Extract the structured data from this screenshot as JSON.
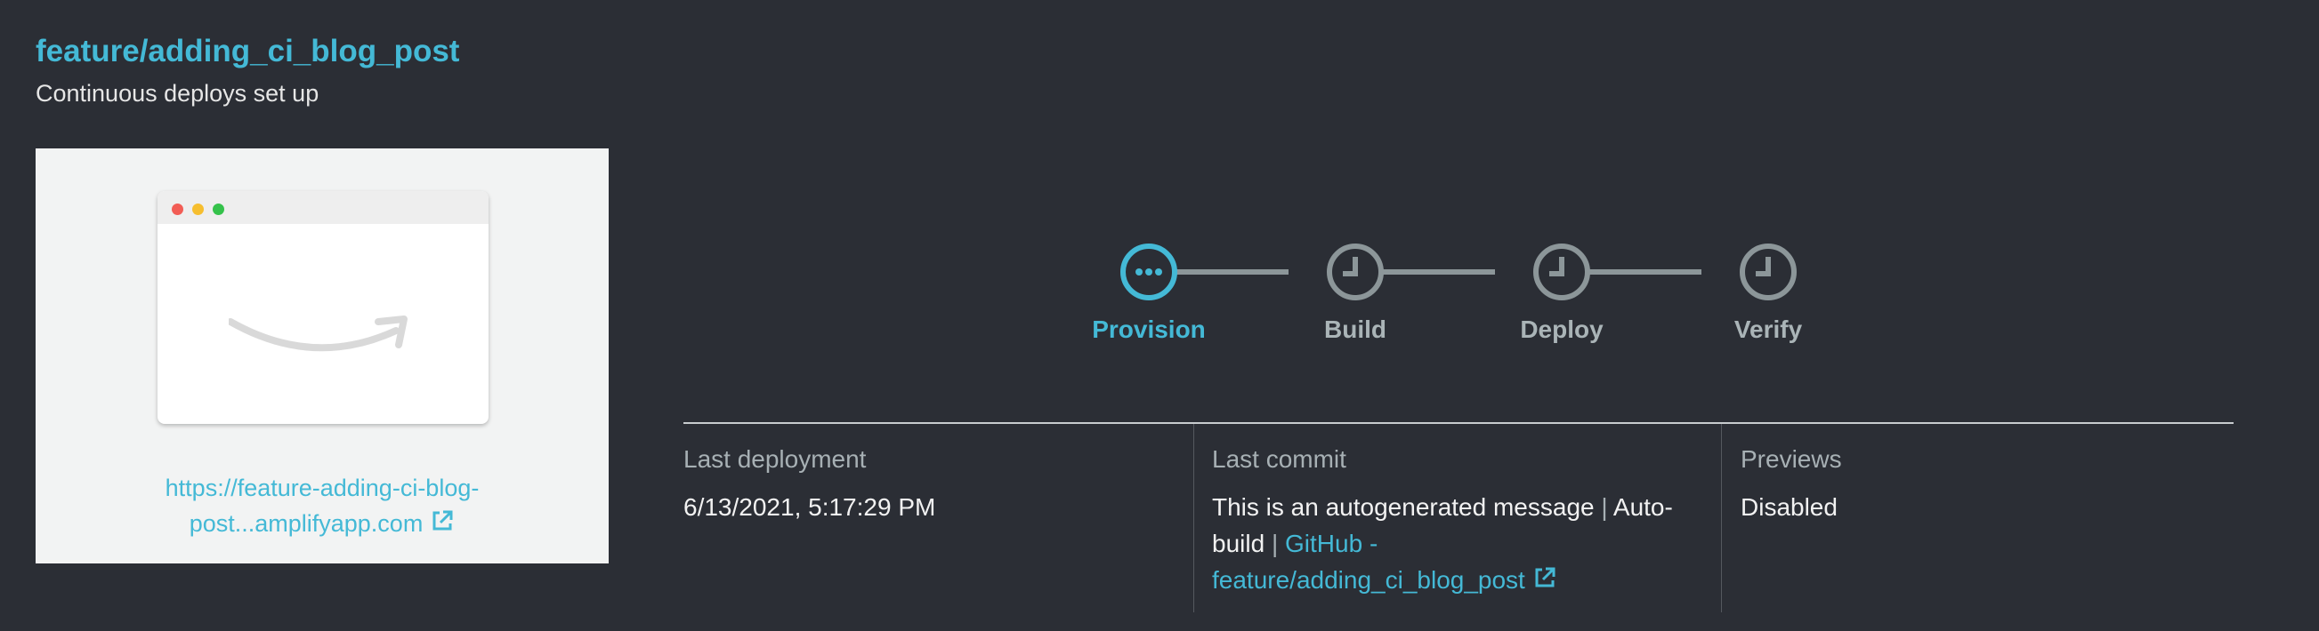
{
  "branch": {
    "name": "feature/adding_ci_blog_post",
    "status": "Continuous deploys set up"
  },
  "preview": {
    "url_line1": "https://feature-adding-ci-blog-",
    "url_line2": "post...amplifyapp.com"
  },
  "steps": [
    {
      "label": "Provision",
      "state": "in-progress"
    },
    {
      "label": "Build",
      "state": "pending"
    },
    {
      "label": "Deploy",
      "state": "pending"
    },
    {
      "label": "Verify",
      "state": "pending"
    }
  ],
  "details": {
    "last_deployment": {
      "label": "Last deployment",
      "value": "6/13/2021, 5:17:29 PM"
    },
    "last_commit": {
      "label": "Last commit",
      "message": "This is an autogenerated message",
      "separator": "|",
      "source": "Auto-build",
      "link_line1": "GitHub -",
      "link_line2": "feature/adding_ci_blog_post"
    },
    "previews": {
      "label": "Previews",
      "value": "Disabled"
    }
  },
  "colors": {
    "accent": "#44b9d6",
    "pending": "#8c9699",
    "background": "#2b2e35"
  }
}
